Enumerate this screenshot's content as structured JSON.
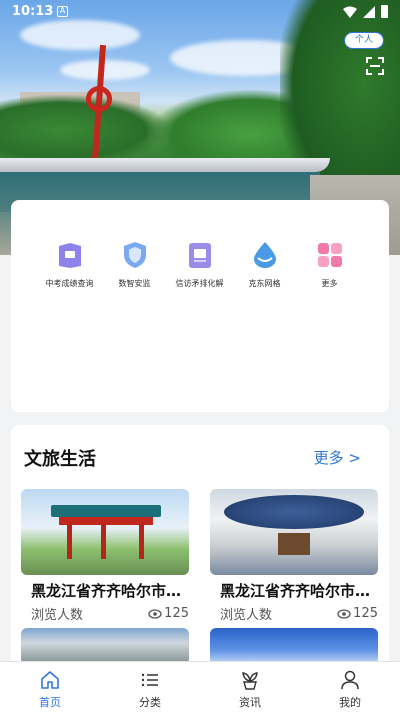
{
  "status_bar": {
    "time": "10:13",
    "notif_icon_letter": "A"
  },
  "header": {
    "personal_button": "个人"
  },
  "services": [
    {
      "label": "中考成绩查询",
      "icon": "exam-score-icon",
      "color": "#7b6fe0"
    },
    {
      "label": "数智安监",
      "icon": "shield-icon",
      "color": "#5a8fe8"
    },
    {
      "label": "信访矛排化解",
      "icon": "petition-icon",
      "color": "#8a7ae0"
    },
    {
      "label": "克东网格",
      "icon": "water-drop-icon",
      "color": "#3f8fdf"
    },
    {
      "label": "更多",
      "icon": "grid-more-icon",
      "color": "#f07ca8"
    }
  ],
  "culture": {
    "title": "文旅生活",
    "more_label": "更多 >",
    "cards": [
      {
        "title": "黑龙江省齐齐哈尔市昂昂溪区",
        "meta_label": "浏览人数",
        "views": "125"
      },
      {
        "title": "黑龙江省齐齐哈尔市昂昂溪区",
        "meta_label": "浏览人数",
        "views": "125"
      }
    ]
  },
  "tabbar": {
    "tabs": [
      {
        "label": "首页",
        "icon": "home-icon",
        "active": true
      },
      {
        "label": "分类",
        "icon": "list-icon",
        "active": false
      },
      {
        "label": "资讯",
        "icon": "sprout-icon",
        "active": false
      },
      {
        "label": "我的",
        "icon": "user-icon",
        "active": false
      }
    ]
  },
  "colors": {
    "accent": "#2f76d6"
  }
}
